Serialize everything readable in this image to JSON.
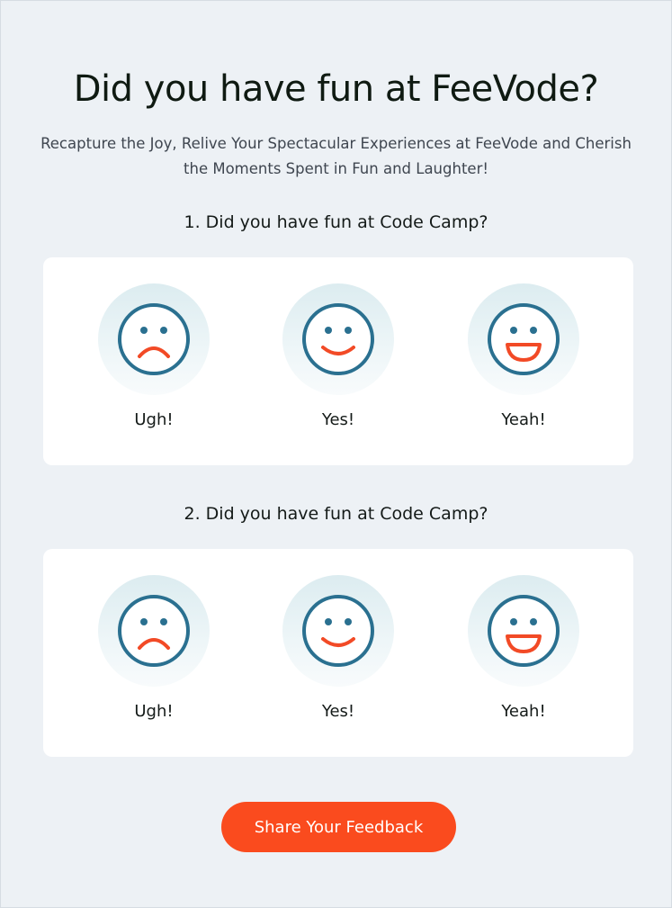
{
  "title": "Did you have fun at FeeVode?",
  "subtitle": "Recapture the Joy, Relive Your Spectacular Experiences at FeeVode and Cherish the Moments Spent in Fun and Laughter!",
  "questions": [
    {
      "text": "1. Did you have fun at Code Camp?",
      "options": [
        {
          "label": "Ugh!",
          "icon": "sad-face-icon"
        },
        {
          "label": "Yes!",
          "icon": "smile-face-icon"
        },
        {
          "label": "Yeah!",
          "icon": "grin-face-icon"
        }
      ]
    },
    {
      "text": "2. Did you have fun at Code Camp?",
      "options": [
        {
          "label": "Ugh!",
          "icon": "sad-face-icon"
        },
        {
          "label": "Yes!",
          "icon": "smile-face-icon"
        },
        {
          "label": "Yeah!",
          "icon": "grin-face-icon"
        }
      ]
    }
  ],
  "submit_label": "Share Your Feedback",
  "colors": {
    "background": "#edf1f5",
    "card": "#ffffff",
    "face_outline": "#2a7090",
    "face_mouth": "#f24a26",
    "accent": "#fa4b1e"
  }
}
